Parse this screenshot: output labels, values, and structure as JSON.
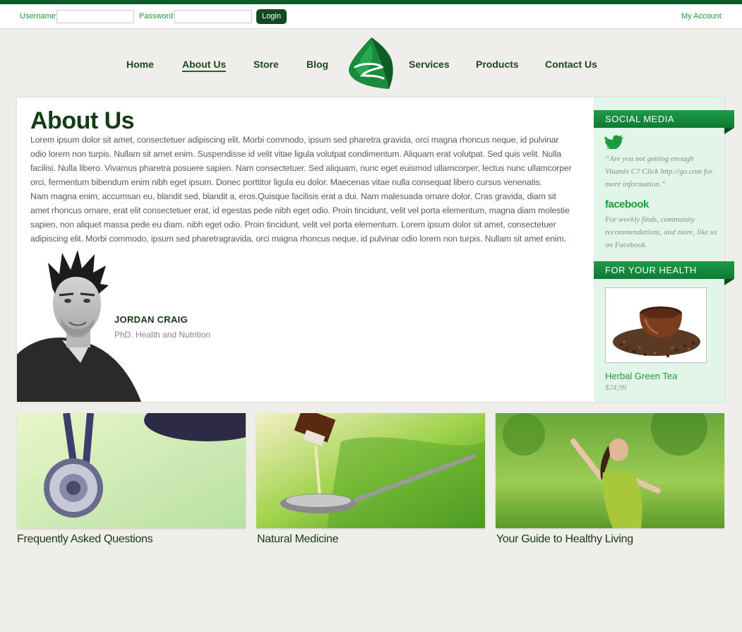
{
  "login": {
    "username_label": "Username",
    "password_label": "Password",
    "username_value": "",
    "password_value": "",
    "login_button": "Login",
    "my_account": "My Account"
  },
  "nav": {
    "items": [
      {
        "label": "Home"
      },
      {
        "label": "About Us",
        "active": true
      },
      {
        "label": "Store"
      },
      {
        "label": "Blog"
      },
      {
        "label": "Services"
      },
      {
        "label": "Products"
      },
      {
        "label": "Contact Us"
      }
    ]
  },
  "main": {
    "title": "About Us",
    "paragraphs": [
      "Lorem ipsum dolor sit amet, consectetuer adipiscing elit. Morbi commodo, ipsum sed pharetra gravida, orci magna rhoncus neque, id pulvinar odio lorem non turpis. Nullam sit amet enim. Suspendisse id velit vitae ligula volutpat condimentum. Aliquam erat volutpat. Sed quis velit. Nulla facilisi. Nulla libero. Vivamus pharetra posuere sapien. Nam consectetuer. Sed aliquam, nunc eget euismod ullamcorper, lectus nunc ullamcorper orci, fermentum bibendum enim nibh eget ipsum. Donec porttitor ligula eu dolor. Maecenas vitae nulla consequat libero cursus venenatis.",
      "Nam magna enim, accumsan eu, blandit sed, blandit a, eros.Quisque facilisis erat a dui. Nam malesuada ornare dolor. Cras gravida, diam sit amet rhoncus ornare, erat elit consectetuer erat, id egestas pede nibh eget odio. Proin tincidunt, velit vel porta elementum, magna diam molestie sapien, non aliquet massa pede eu diam. nibh eget odio. Proin tincidunt, velit vel porta elementum. Lorem ipsum dolor sit amet, consectetuer adipiscing elit. Morbi commodo, ipsum sed pharetragravida, orci magna rhoncus neque, id pulvinar odio lorem non turpis. Nullam sit amet enim."
    ],
    "person": {
      "name": "JORDAN CRAIG",
      "title": "PhD. Health and Nutrition"
    }
  },
  "sidebar": {
    "social_heading": "SOCIAL MEDIA",
    "twitter_quote": "“Are you not getting enough Vitamin C? Click http://go.com for more information.”",
    "facebook_label": "facebook",
    "facebook_text": "For weekly finds, community recommendations, and more, like us on Facebook.",
    "health_heading": "FOR YOUR HEALTH",
    "product_name": "Herbal Green Tea",
    "product_price": "$24,99"
  },
  "tiles": [
    {
      "caption": "Frequently Asked Questions"
    },
    {
      "caption": "Natural Medicine"
    },
    {
      "caption": "Your Guide to Healthy Living"
    }
  ],
  "colors": {
    "brand_dark": "#0e5a28",
    "brand_green": "#1e9a3e",
    "sidebar_bg": "#e1f6e8",
    "page_bg": "#f0eeea"
  },
  "icons": [
    "twitter-icon",
    "facebook-logo",
    "leaf-logo"
  ]
}
